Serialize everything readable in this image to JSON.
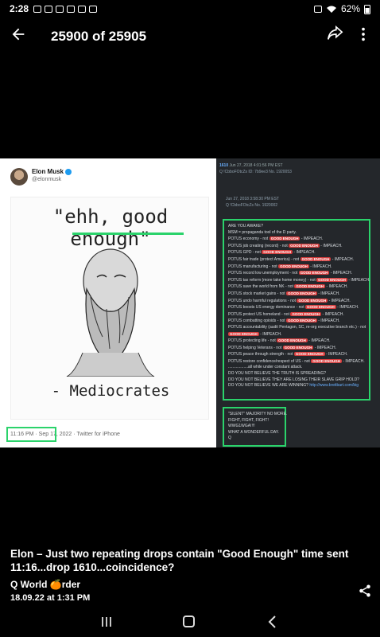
{
  "status_bar": {
    "time": "2:28",
    "battery": "62%"
  },
  "app_bar": {
    "counter": "25900 of 25905"
  },
  "tweet": {
    "name": "Elon Musk",
    "handle": "@elonmusk",
    "meme_title": "\"ehh, good enough\"",
    "meme_caption": "- Mediocrates",
    "timestamp": "11:16 PM · Sep 17, 2022",
    "source": "· Twitter for iPhone"
  },
  "qdrop": {
    "number": "1610",
    "header_date": "Jun 27, 2018 4:01:56 PM EST",
    "header_trip": "Q !CbboFOtcZs",
    "header_id": "ID: 7b9ee3",
    "header_ref": "No. 1920053",
    "sub_date": "Jun 27, 2018 3:58:30 PM EST",
    "sub_trip": "Q !CbboFOtcZs",
    "sub_ref": "No. 1920002",
    "lines": [
      {
        "text": "ARE YOU AWAKE?",
        "tag": "",
        "tail": ""
      },
      {
        "text": "MSM = propaganda tool of the D party.",
        "tag": "",
        "tail": ""
      },
      {
        "text": "POTUS economy - not",
        "tag": "GOOD ENOUGH",
        "tail": "- IMPEACH."
      },
      {
        "text": "POTUS job creating (record) - not",
        "tag": "GOOD ENOUGH",
        "tail": "- IMPEACH."
      },
      {
        "text": "POTUS GPD - not",
        "tag": "GOOD ENOUGH",
        "tail": "- IMPEACH."
      },
      {
        "text": "POTUS fair trade (protect America) - not",
        "tag": "GOOD ENOUGH",
        "tail": "- IMPEACH."
      },
      {
        "text": "POTUS manufacturing - not",
        "tag": "GOOD ENOUGH",
        "tail": "- IMPEACH."
      },
      {
        "text": "POTUS record low unemployment - not",
        "tag": "GOOD ENOUGH",
        "tail": "- IMPEACH."
      },
      {
        "text": "POTUS tax reform (more take home money) - not",
        "tag": "GOOD ENOUGH",
        "tail": "- IMPEACH."
      },
      {
        "text": "POTUS save the world from NK - not",
        "tag": "GOOD ENOUGH",
        "tail": "- IMPEACH."
      },
      {
        "text": "POTUS stock market gains - not",
        "tag": "GOOD ENOUGH",
        "tail": "- IMPEACH."
      },
      {
        "text": "POTUS undo harmful regulations - not",
        "tag": "GOOD ENOUGH",
        "tail": "- IMPEACH."
      },
      {
        "text": "POTUS boosts US energy dominance - not",
        "tag": "GOOD ENOUGH",
        "tail": "- IMPEACH."
      },
      {
        "text": "POTUS protect US homeland - not",
        "tag": "GOOD ENOUGH",
        "tail": "- IMPEACH."
      },
      {
        "text": "POTUS combatting opioids - not",
        "tag": "GOOD ENOUGH",
        "tail": "- IMPEACH."
      },
      {
        "text": "POTUS accountability (audit Pentagon, SC, re-org executive branch etc.) - not",
        "tag": "",
        "tail": ""
      },
      {
        "text": "",
        "tag": "GOOD ENOUGH",
        "tail": "- IMPEACH."
      },
      {
        "text": "POTUS protecting life - not",
        "tag": "GOOD ENOUGH",
        "tail": "- IMPEACH."
      },
      {
        "text": "POTUS helping Veterans - not",
        "tag": "GOOD ENOUGH",
        "tail": "- IMPEACH."
      },
      {
        "text": "POTUS peace through strength - not",
        "tag": "GOOD ENOUGH",
        "tail": "- IMPEACH."
      },
      {
        "text": "POTUS restore confidence/respect of US - not",
        "tag": "GOOD ENOUGH",
        "tail": "- IMPEACH."
      },
      {
        "text": "..................all while under constant attack.",
        "tag": "",
        "tail": ""
      },
      {
        "text": "DO YOU NOT BELIEVE THE TRUTH IS SPREADING?",
        "tag": "",
        "tail": ""
      },
      {
        "text": "DO YOU NOT BELIEVE THEY ARE LOSING THEIR SLAVE GRIP HOLD?",
        "tag": "",
        "tail": ""
      },
      {
        "text": "DO YOU NOT BELIEVE WE ARE WINNING?",
        "tag": "",
        "tail": "http://www.breitbart.com/big"
      }
    ],
    "closing": [
      "\"SILENT\" MAJORITY NO MORE.",
      "FIGHT, FIGHT, FIGHT!",
      "WWG1WGA!!!!",
      "WHAT A WONDERFUL DAY.",
      "Q"
    ]
  },
  "post": {
    "caption": "Elon – Just two repeating drops contain \"Good Enough\" time sent 11:16...drop 1610...coincidence?",
    "author": "Q World 🍊rder",
    "date": "18.09.22 at 1:31 PM"
  },
  "icons": [
    "back-arrow-icon",
    "share-icon",
    "more-vert-icon",
    "recent-apps-icon",
    "home-icon",
    "nav-back-icon"
  ]
}
